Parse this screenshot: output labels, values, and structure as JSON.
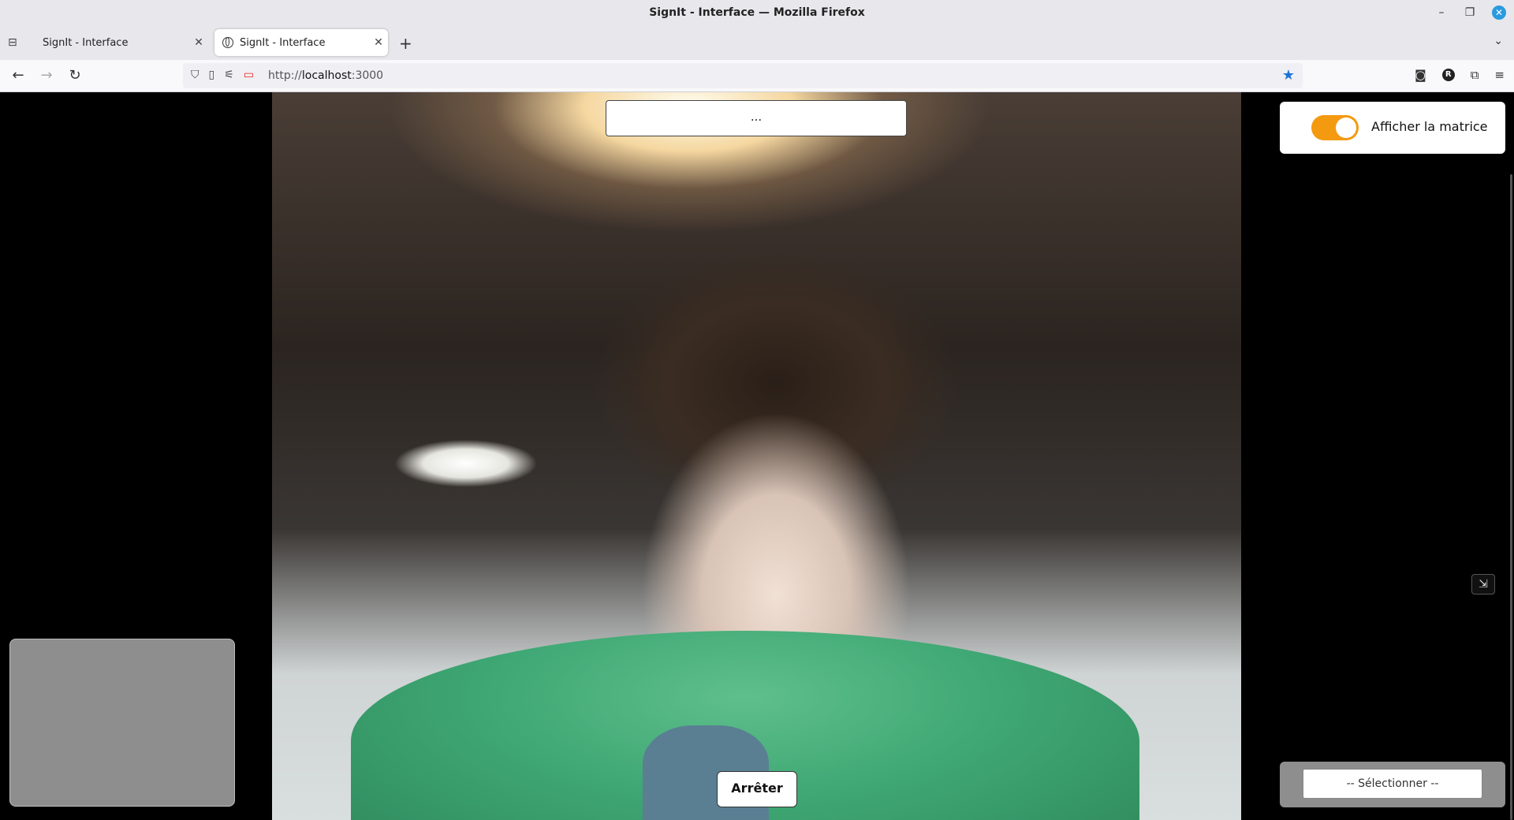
{
  "window": {
    "title": "SignIt - Interface — Mozilla Firefox"
  },
  "tabs": [
    {
      "label": "SignIt - Interface",
      "active": false
    },
    {
      "label": "SignIt - Interface",
      "active": true
    }
  ],
  "navbar": {
    "url_prefix": "http://",
    "url_host": "localhost",
    "url_port": ":3000",
    "account_initial": "R"
  },
  "main": {
    "result_text": "...",
    "stop_label": "Arrêter",
    "matrix_toggle": {
      "label": "Afficher la matrice",
      "on": true
    },
    "select": {
      "selected": "-- Sélectionner --"
    }
  },
  "colors": {
    "accent": "#f49a10",
    "panel_gray": "#8e8e8e",
    "bookmark_star": "#1c74d6"
  },
  "icons": [
    "back-arrow-icon",
    "forward-arrow-icon",
    "reload-icon",
    "shield-icon",
    "page-icon",
    "permissions-icon",
    "camera-icon",
    "bookmark-star-icon",
    "pocket-icon",
    "extensions-icon",
    "menu-icon",
    "picture-in-picture-icon"
  ]
}
